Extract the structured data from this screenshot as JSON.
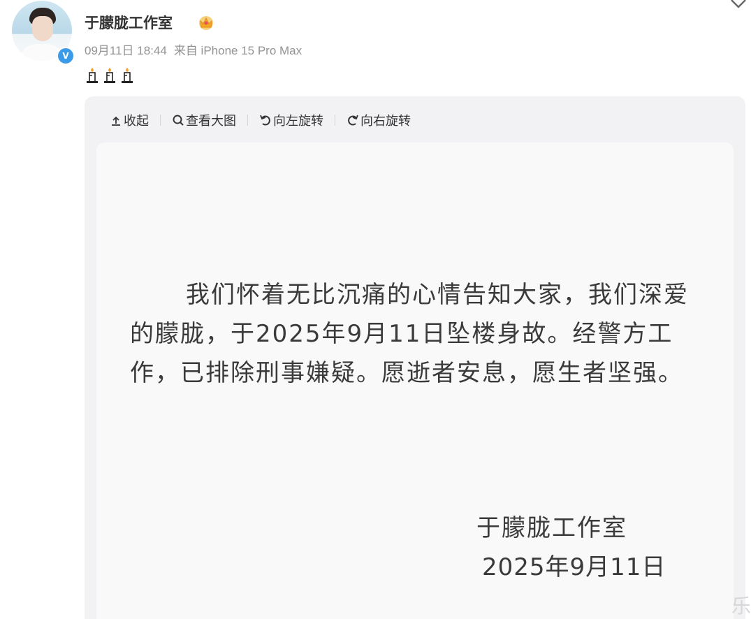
{
  "post": {
    "author": "于朦胧工作室",
    "verified_badge": "V",
    "date": "09月11日 18:44",
    "source": "来自 iPhone 15 Pro Max",
    "content_icons": [
      "candle-icon",
      "candle-icon",
      "candle-icon"
    ]
  },
  "toolbar": {
    "collapse": "收起",
    "view_large": "查看大图",
    "rotate_left": "向左旋转",
    "rotate_right": "向右旋转"
  },
  "image": {
    "statement": "我们怀着无比沉痛的心情告知大家，我们深爱的朦胧，于2025年9月11日坠楼身故。经警方工作，已排除刑事嫌疑。愿逝者安息，愿生者坚强。",
    "signature": "于朦胧工作室",
    "signature_date": "2025年9月11日"
  },
  "watermark": "乐",
  "colors": {
    "accent_blue": "#3c9be8",
    "viewer_bg": "#f2f2f4",
    "meta_text": "#939393"
  }
}
